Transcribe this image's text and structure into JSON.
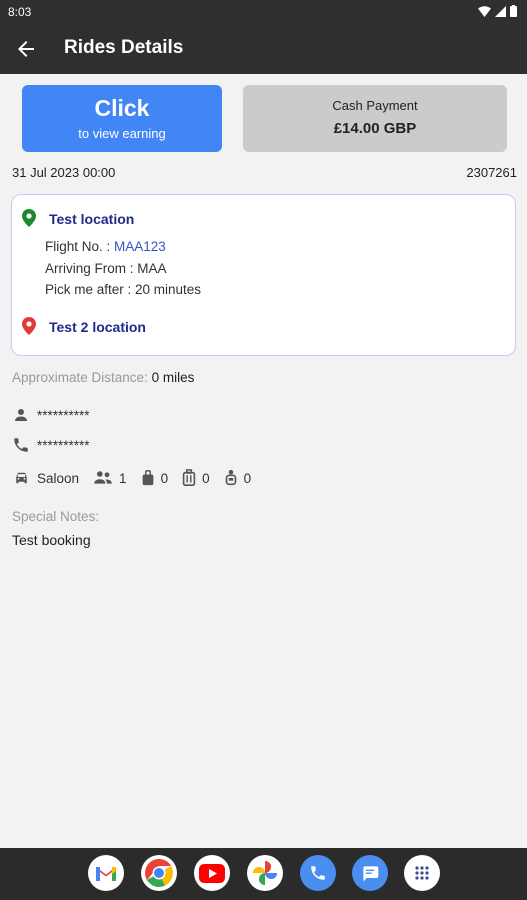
{
  "status": {
    "time": "8:03"
  },
  "appbar": {
    "title": "Rides Details"
  },
  "earning": {
    "title": "Click",
    "subtitle": "to view earning"
  },
  "payment": {
    "label": "Cash Payment",
    "amount": "£14.00 GBP"
  },
  "ride": {
    "date": "31 Jul 2023 00:00",
    "id": "2307261"
  },
  "pickup": {
    "name": "Test location",
    "flight_label": "Flight No. : ",
    "flight_no": "MAA123",
    "arriving": "Arriving From : MAA",
    "pickup_after": "Pick me after : 20 minutes"
  },
  "dropoff": {
    "name": "Test 2 location"
  },
  "distance": {
    "label": "Approximate Distance:",
    "value": "0 miles"
  },
  "passenger": {
    "name": "**********",
    "phone": "**********"
  },
  "vehicle": {
    "type": "Saloon",
    "passengers": "1",
    "luggage": "0",
    "suitcases": "0",
    "child_seats": "0"
  },
  "notes": {
    "label": "Special Notes:",
    "value": "Test booking"
  },
  "colors": {
    "accent": "#4285f4",
    "bar": "#2f2f2f",
    "pickup_pin": "#1a8a2e",
    "dropoff_pin": "#e53935"
  },
  "dock": [
    "gmail-icon",
    "chrome-icon",
    "youtube-icon",
    "photos-icon",
    "phone-icon",
    "messages-icon",
    "apps-icon"
  ]
}
